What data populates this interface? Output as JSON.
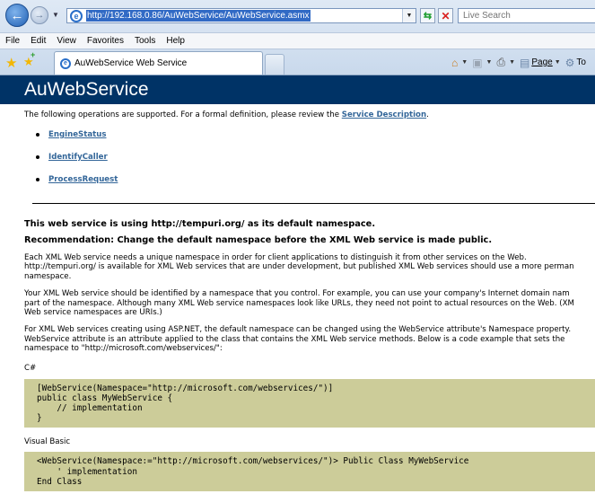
{
  "browser": {
    "url": "http://192.168.0.86/AuWebService/AuWebService.asmx",
    "search_placeholder": "Live Search",
    "menu": [
      "File",
      "Edit",
      "View",
      "Favorites",
      "Tools",
      "Help"
    ],
    "tab_title": "AuWebService Web Service",
    "commands": {
      "page": "Page",
      "tools": "To"
    }
  },
  "page": {
    "title": "AuWebService",
    "intro": "The following operations are supported. For a formal definition, please review the ",
    "service_description_link": "Service Description",
    "intro_end": ".",
    "operations": [
      "EngineStatus",
      "IdentifyCaller",
      "ProcessRequest"
    ],
    "namespace_heading": "This web service is using http://tempuri.org/ as its default namespace.",
    "recommendation_heading": "Recommendation: Change the default namespace before the XML Web service is made public.",
    "para1": [
      "Each XML Web service needs a unique namespace in order for client applications to distinguish it from other services on the Web.",
      "http://tempuri.org/ is available for XML Web services that are under development, but published XML Web services should use a more perman",
      "namespace."
    ],
    "para2": [
      "Your XML Web service should be identified by a namespace that you control. For example, you can use your company's Internet domain nam",
      "part of the namespace. Although many XML Web service namespaces look like URLs, they need not point to actual resources on the Web. (XM",
      "Web service namespaces are URIs.)"
    ],
    "para3": [
      "For XML Web services creating using ASP.NET, the default namespace can be changed using the WebService attribute's Namespace property.",
      "WebService attribute is an attribute applied to the class that contains the XML Web service methods. Below is a code example that sets the",
      "namespace to \"http://microsoft.com/webservices/\":"
    ],
    "csharp_label": "C#",
    "csharp_code": "[WebService(Namespace=\"http://microsoft.com/webservices/\")]\npublic class MyWebService {\n    // implementation\n}",
    "vb_label": "Visual Basic",
    "vb_code": "<WebService(Namespace:=\"http://microsoft.com/webservices/\")> Public Class MyWebService\n    ' implementation\nEnd Class"
  }
}
